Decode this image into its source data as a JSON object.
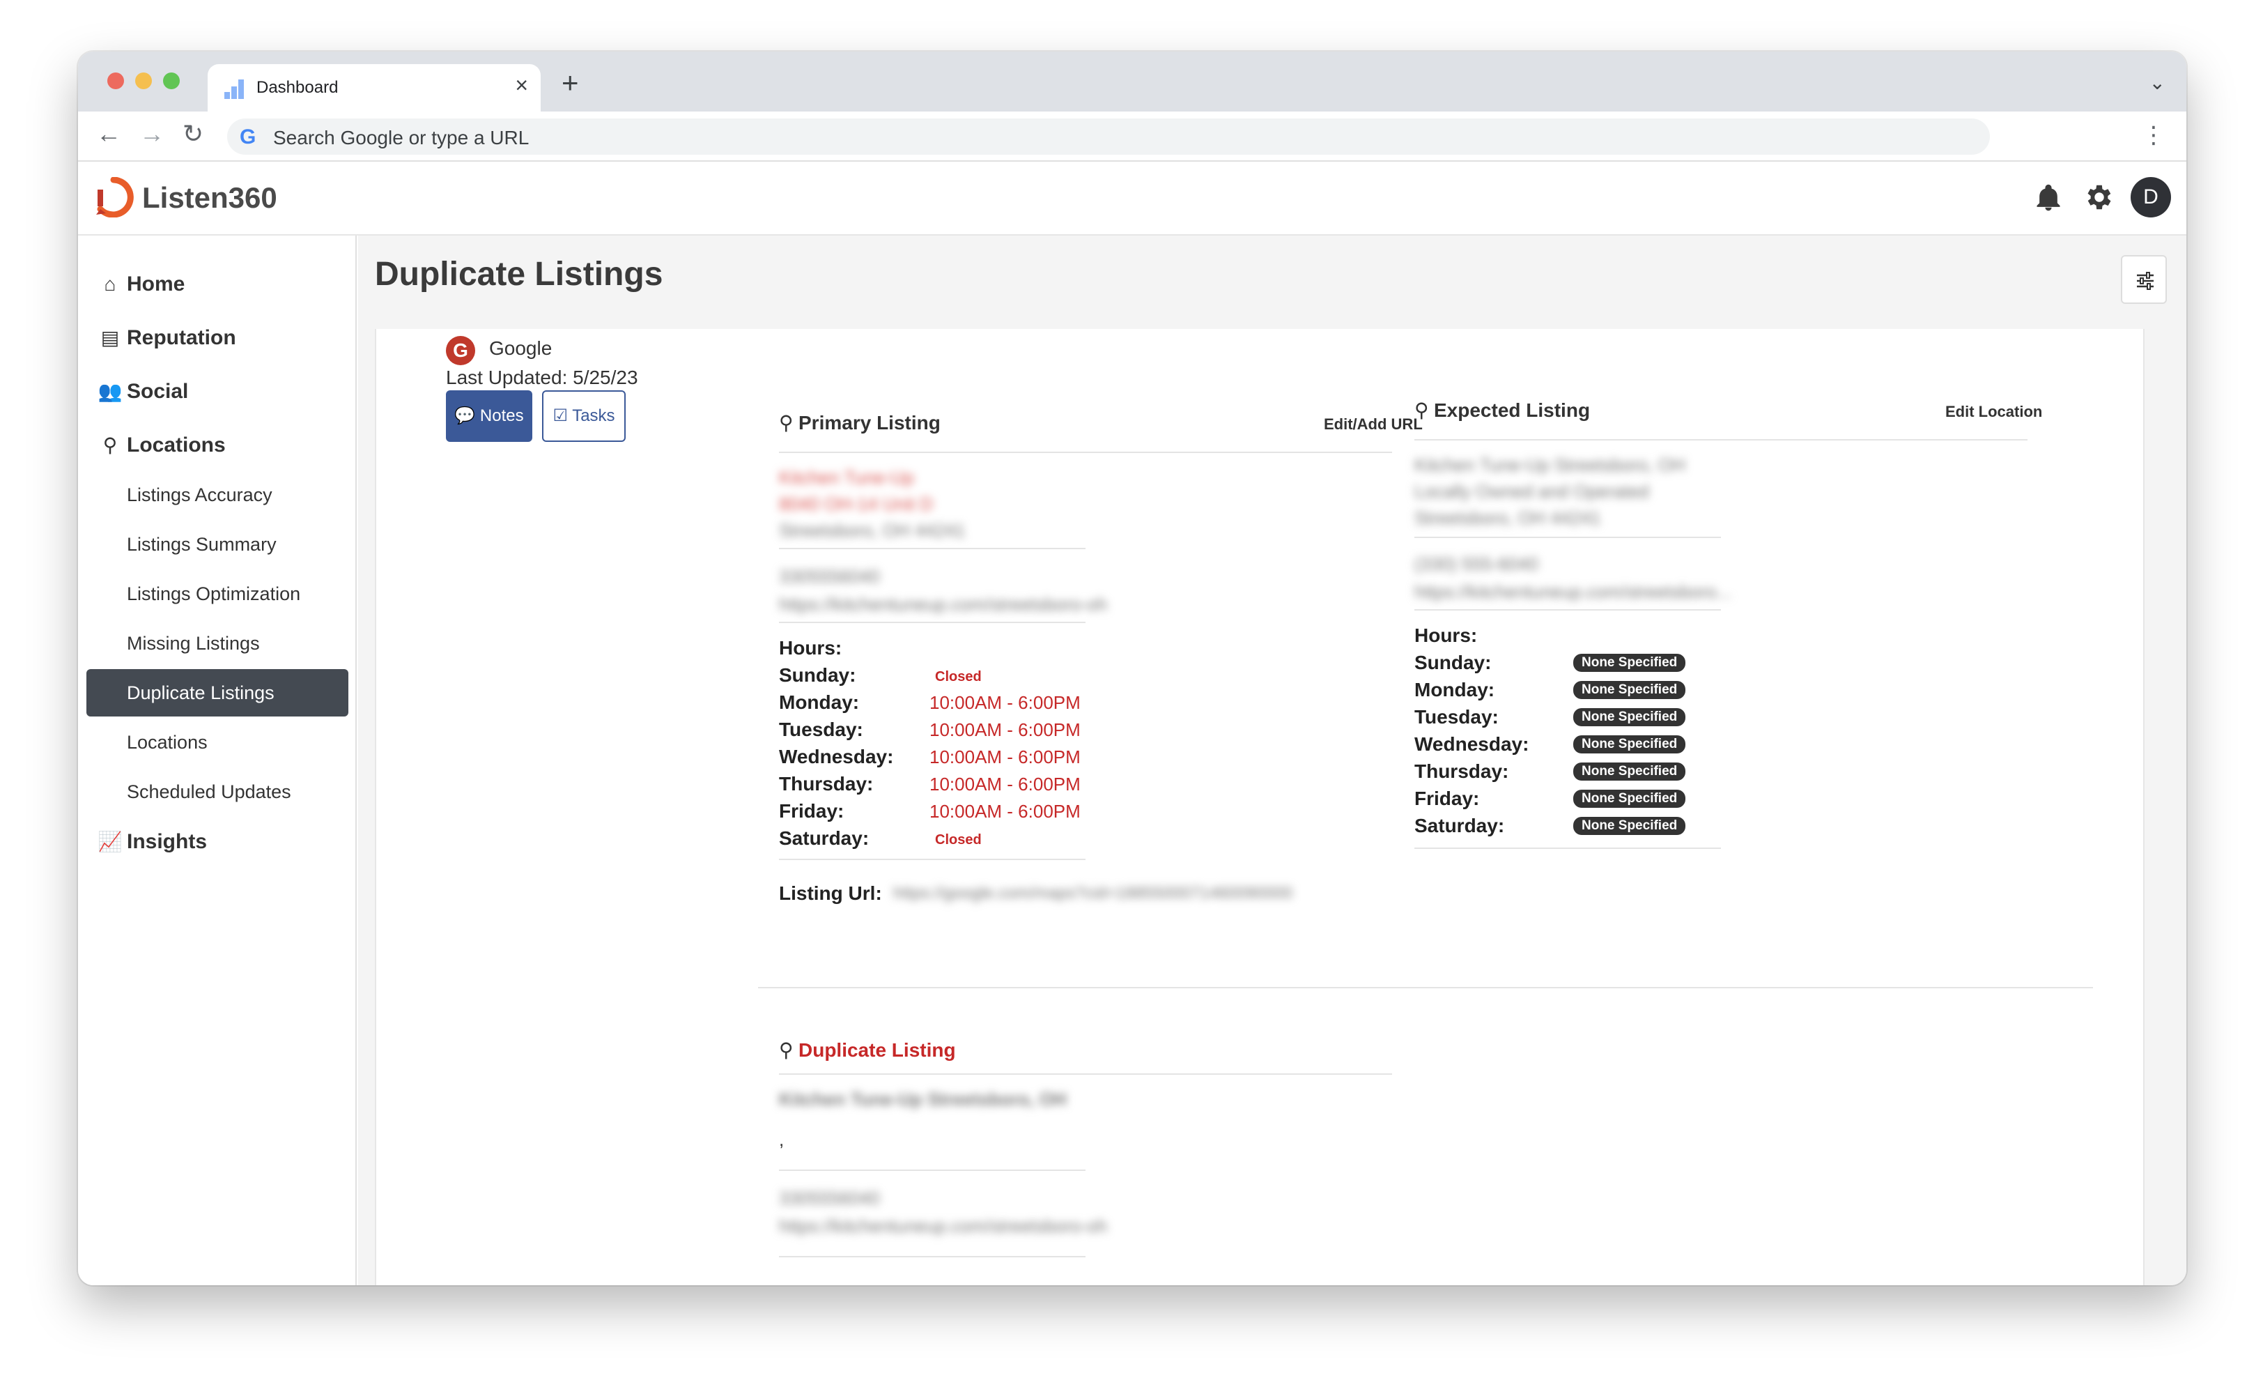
{
  "browser": {
    "tab_title": "Dashboard",
    "omnibox_placeholder": "Search Google or type a URL"
  },
  "app": {
    "logo_text": "Listen360",
    "avatar_initial": "D",
    "brand_color": "#e85d2a"
  },
  "sidebar": {
    "items": [
      {
        "label": "Home",
        "icon": "home-icon"
      },
      {
        "label": "Reputation",
        "icon": "comment-icon"
      },
      {
        "label": "Social",
        "icon": "users-icon"
      },
      {
        "label": "Locations",
        "icon": "map-pin-icon"
      }
    ],
    "sub_items": [
      {
        "label": "Listings Accuracy"
      },
      {
        "label": "Listings Summary"
      },
      {
        "label": "Listings Optimization"
      },
      {
        "label": "Missing Listings"
      },
      {
        "label": "Duplicate Listings",
        "active": true
      },
      {
        "label": "Locations"
      },
      {
        "label": "Scheduled Updates"
      }
    ],
    "insights": {
      "label": "Insights",
      "icon": "chart-icon"
    }
  },
  "page": {
    "title": "Duplicate Listings"
  },
  "listing": {
    "source": "Google",
    "source_initial": "G",
    "last_updated": "Last Updated: 5/25/23",
    "notes_label": "Notes",
    "tasks_label": "Tasks"
  },
  "primary": {
    "title": "Primary Listing",
    "action": "Edit/Add URL",
    "name": "Kitchen Tune-Up",
    "address1": "8040 OH-14 Unit D",
    "address2": "Streetsboro, OH 44241",
    "phone": "3305556040",
    "website": "https://kitchentuneup.com/streetsboro-oh",
    "hours_label": "Hours:",
    "hours": [
      {
        "day": "Sunday:",
        "value": "Closed",
        "closed": true
      },
      {
        "day": "Monday:",
        "value": "10:00AM - 6:00PM"
      },
      {
        "day": "Tuesday:",
        "value": "10:00AM - 6:00PM"
      },
      {
        "day": "Wednesday:",
        "value": "10:00AM - 6:00PM"
      },
      {
        "day": "Thursday:",
        "value": "10:00AM - 6:00PM"
      },
      {
        "day": "Friday:",
        "value": "10:00AM - 6:00PM"
      },
      {
        "day": "Saturday:",
        "value": "Closed",
        "closed": true
      }
    ],
    "url_label": "Listing Url:",
    "url_value": "https://google.com/maps?cid=1885500071460090000"
  },
  "expected": {
    "title": "Expected Listing",
    "action": "Edit Location",
    "name": "Kitchen Tune-Up Streetsboro, OH",
    "line1": "Locally Owned and Operated",
    "line2": "Streetsboro, OH 44241",
    "phone": "(330) 555-6040",
    "website": "https://kitchentuneup.com/streetsboro...",
    "hours_label": "Hours:",
    "hours": [
      {
        "day": "Sunday:",
        "value": "None Specified"
      },
      {
        "day": "Monday:",
        "value": "None Specified"
      },
      {
        "day": "Tuesday:",
        "value": "None Specified"
      },
      {
        "day": "Wednesday:",
        "value": "None Specified"
      },
      {
        "day": "Thursday:",
        "value": "None Specified"
      },
      {
        "day": "Friday:",
        "value": "None Specified"
      },
      {
        "day": "Saturday:",
        "value": "None Specified"
      }
    ]
  },
  "duplicate": {
    "title": "Duplicate Listing",
    "name": "Kitchen Tune-Up Streetsboro, OH",
    "comma": ",",
    "phone": "3305556040",
    "website": "https://kitchentuneup.com/streetsboro-oh"
  }
}
